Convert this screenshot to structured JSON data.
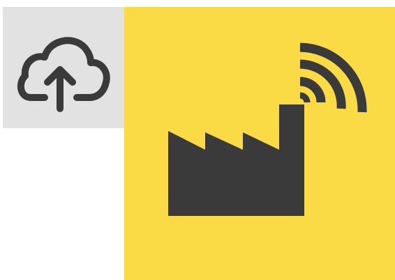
{
  "tiles": {
    "upload": {
      "icon": "cloud-upload-icon",
      "background": "#e2e2e2",
      "icon_color": "#3a3a3a"
    },
    "factory": {
      "icon": "smart-factory-wireless-icon",
      "background": "#fbdb45",
      "icon_color": "#3a3a3a"
    }
  }
}
